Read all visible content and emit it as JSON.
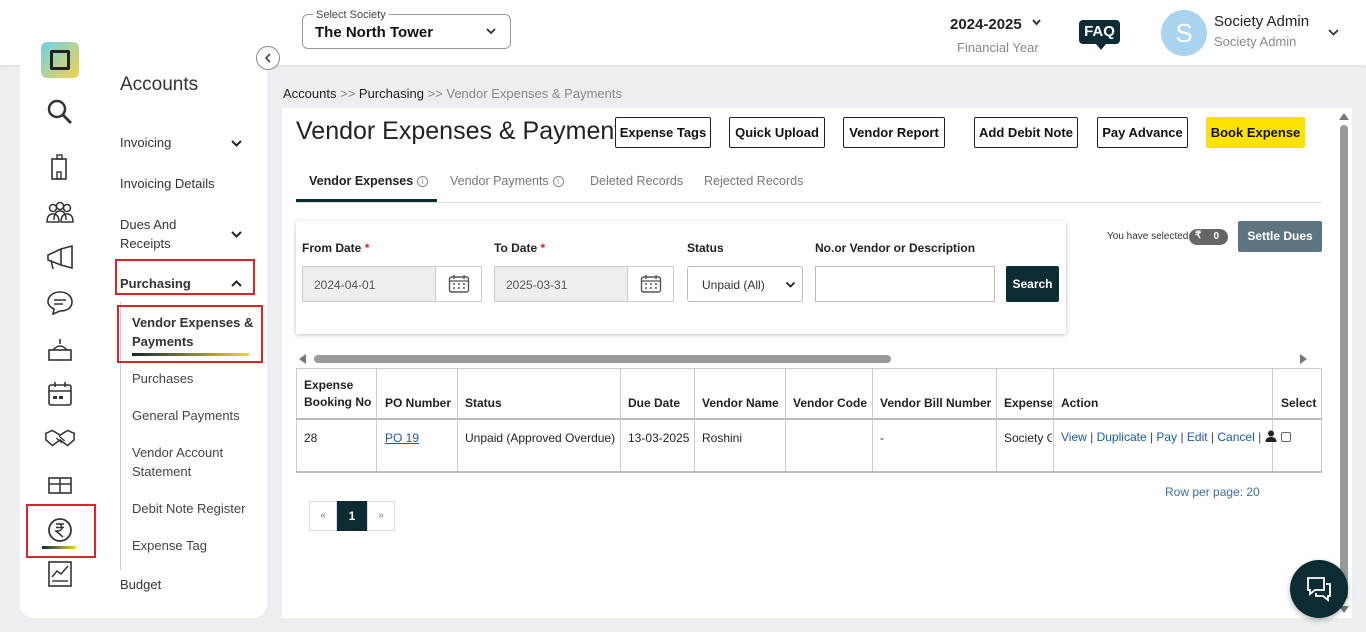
{
  "header": {
    "society_label": "Select Society",
    "society_value": "The North Tower",
    "year": "2024-2025",
    "year_caption": "Financial Year",
    "faq": "FAQ",
    "avatar_letter": "S",
    "user_name": "Society Admin",
    "user_role": "Society Admin"
  },
  "sidebar": {
    "title": "Accounts",
    "items": {
      "invoicing": "Invoicing",
      "invoicing_details": "Invoicing Details",
      "dues_line1": "Dues And",
      "dues_line2": "Receipts",
      "purchasing": "Purchasing",
      "vendor_exp_line1": "Vendor Expenses &",
      "vendor_exp_line2": "Payments",
      "purchases": "Purchases",
      "general_payments": "General Payments",
      "vendor_account_line1": "Vendor Account",
      "vendor_account_line2": "Statement",
      "debit_note_register": "Debit Note Register",
      "expense_tag": "Expense Tag",
      "budget": "Budget"
    }
  },
  "breadcrumb": {
    "accounts": "Accounts",
    "sep1": " >> ",
    "purchasing": "Purchasing",
    "sep2": " >> ",
    "current": "Vendor Expenses & Payments"
  },
  "page": {
    "title": "Vendor Expenses & Payments",
    "buttons": {
      "expense_tags": "Expense Tags",
      "quick_upload": "Quick Upload",
      "vendor_report": "Vendor Report",
      "add_debit_note": "Add Debit Note",
      "pay_advance": "Pay Advance",
      "book_expense": "Book Expense"
    },
    "tabs": {
      "vendor_expenses": "Vendor Expenses",
      "vendor_payments": "Vendor Payments",
      "deleted_records": "Deleted Records",
      "rejected_records": "Rejected Records"
    }
  },
  "filters": {
    "from_label": "From Date",
    "to_label": "To Date",
    "required_mark": "*",
    "status_label": "Status",
    "search_label": "No.or Vendor or Description",
    "from_value": "2024-04-01",
    "to_value": "2025-03-31",
    "status_value": "Unpaid (All)",
    "search_value": "",
    "search_button": "Search"
  },
  "selection": {
    "text": "You have selected",
    "currency": "₹",
    "count": "0",
    "settle_button": "Settle Dues"
  },
  "table": {
    "headers": {
      "booking_line1": "Expense",
      "booking_line2": "Booking No",
      "po": "PO Number",
      "status": "Status",
      "due": "Due Date",
      "vendor": "Vendor Name",
      "code": "Vendor Code",
      "bill": "Vendor Bill Number",
      "expense": "Expense",
      "action": "Action",
      "select": "Select"
    },
    "row": {
      "booking": "28",
      "po": "PO 19",
      "status": "Unpaid (Approved Overdue)",
      "due": "13-03-2025",
      "vendor": "Roshini",
      "code": "",
      "bill": "-",
      "expense": "Society G",
      "actions": {
        "view": "View",
        "duplicate": "Duplicate",
        "pay": "Pay",
        "edit": "Edit",
        "cancel": "Cancel",
        "sep": " | "
      }
    }
  },
  "pagination": {
    "rows_per_page": "Row per page: 20",
    "prev": "«",
    "current": "1",
    "next": "»"
  },
  "icons": [
    "logo-icon",
    "search-icon",
    "building-icon",
    "people-icon",
    "megaphone-icon",
    "chat-icon",
    "service-icon",
    "calendar-icon",
    "handshake-icon",
    "gift-icon",
    "rupee-icon",
    "chart-icon",
    "collapse-icon",
    "calendar-icon",
    "chat-support-icon"
  ],
  "colors": {
    "primary": "#0d2b33",
    "accent_yellow": "#fde200",
    "highlight_red": "#d7262b",
    "link_blue": "#1a5aa8",
    "settle_gray": "#5c7581"
  }
}
